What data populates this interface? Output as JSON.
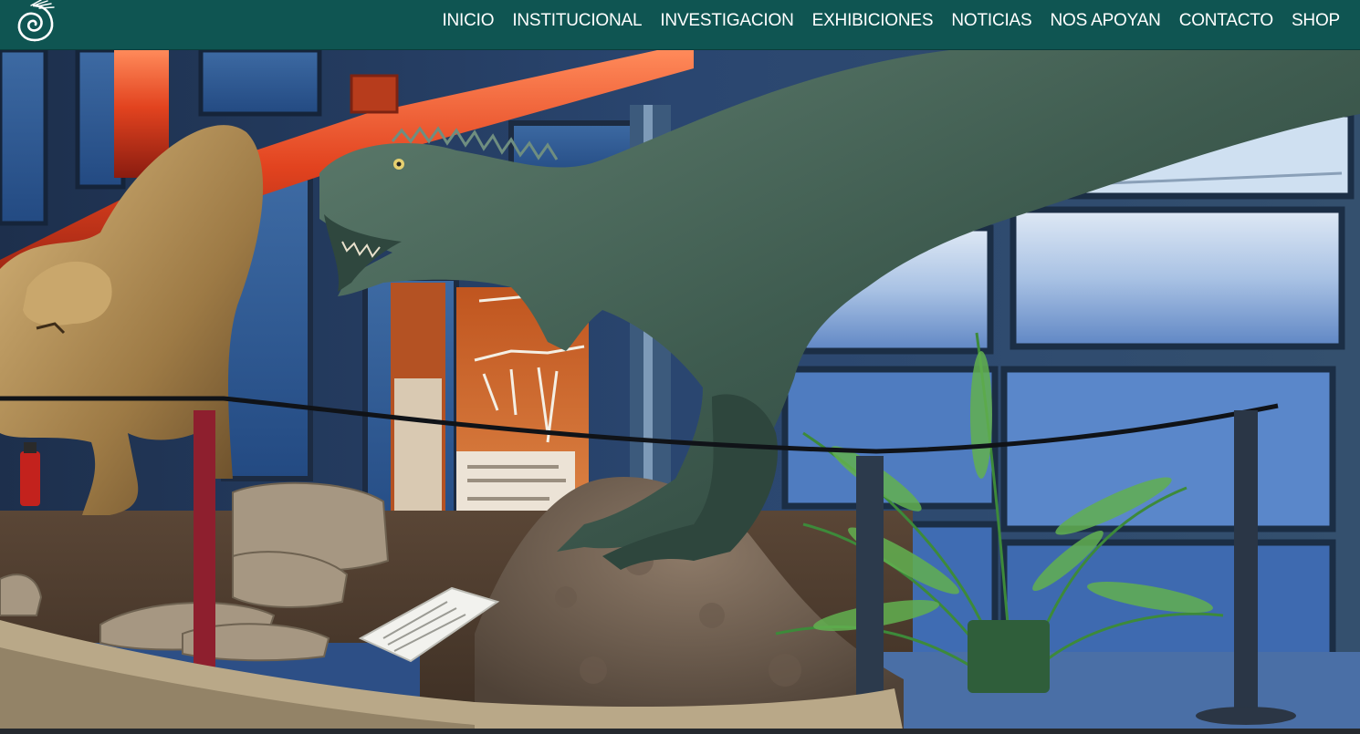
{
  "header": {
    "logo_icon": "spiral-shell-icon",
    "nav": [
      {
        "label": "INICIO"
      },
      {
        "label": "INSTITUCIONAL"
      },
      {
        "label": "INVESTIGACION"
      },
      {
        "label": "EXHIBICIONES"
      },
      {
        "label": "NOTICIAS"
      },
      {
        "label": "NOS APOYAN"
      },
      {
        "label": "CONTACTO"
      },
      {
        "label": "SHOP"
      }
    ]
  },
  "colors": {
    "header_bg": "#0f5552",
    "nav_text": "#ffffff"
  }
}
